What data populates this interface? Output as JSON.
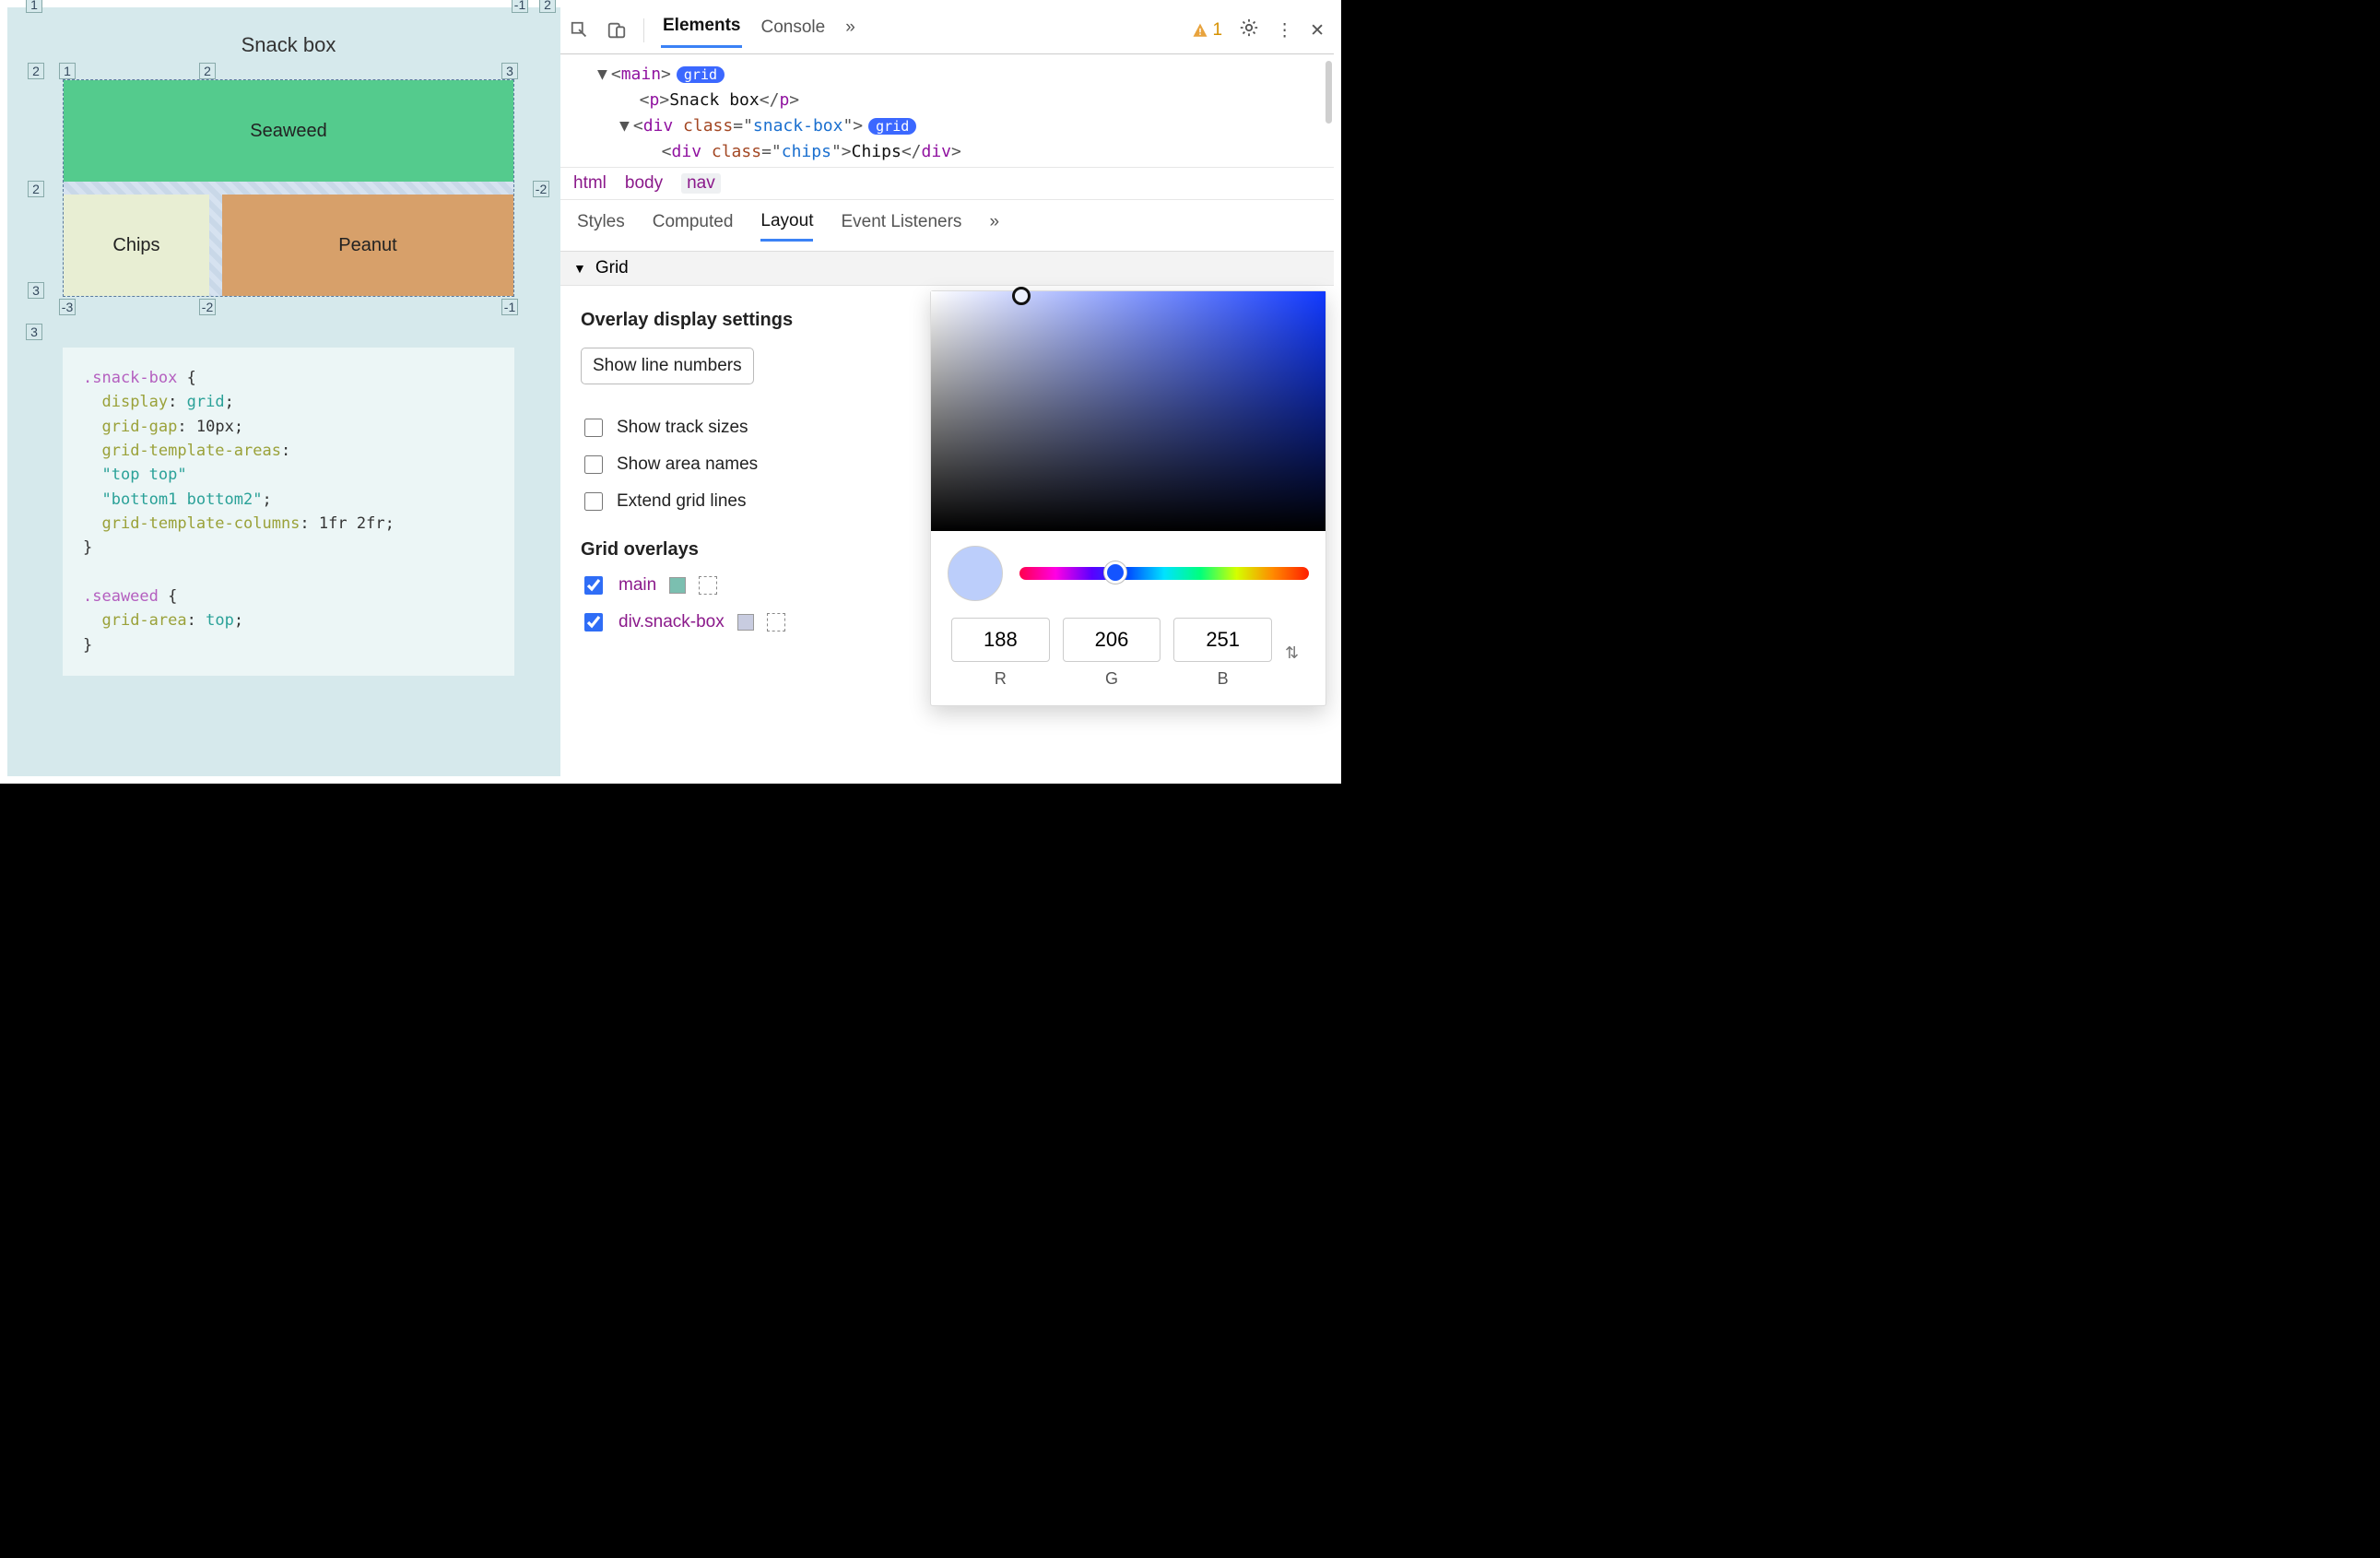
{
  "preview": {
    "title": "Snack box",
    "grid": {
      "seaweed": "Seaweed",
      "chips": "Chips",
      "peanut": "Peanut"
    },
    "lineLabels": {
      "topOuter1": "1",
      "rightOuterNeg1": "-1",
      "cornerTopRight": "2",
      "row2": "2",
      "col1": "1",
      "col2": "2",
      "col3": "3",
      "midRowLeft": "2",
      "midRowRight": "-2",
      "bottomCorner": "3",
      "botNeg3": "-3",
      "botNeg2": "-2",
      "botNeg1": "-1",
      "leftBottom": "3"
    },
    "css": {
      "rule1": {
        "selector": ".snack-box",
        "lines": [
          {
            "prop": "display",
            "val": "grid"
          },
          {
            "prop": "grid-gap",
            "val": "10px"
          },
          {
            "prop": "grid-template-areas",
            "val": ""
          },
          {
            "prop": "",
            "val": "\"top top\""
          },
          {
            "prop": "",
            "val": "\"bottom1 bottom2\";"
          },
          {
            "prop": "grid-template-columns",
            "val": "1fr 2fr"
          }
        ]
      },
      "rule2": {
        "selector": ".seaweed",
        "prop": "grid-area",
        "val": "top"
      }
    }
  },
  "devtools": {
    "topTabs": {
      "elements": "Elements",
      "console": "Console",
      "more": "»"
    },
    "warn": {
      "count": "1"
    },
    "dom": {
      "l1": {
        "pre": "▼",
        "tag": "main",
        "chip": "grid"
      },
      "l2": {
        "tag": "p",
        "text": "Snack box"
      },
      "l3": {
        "pre": "▼",
        "tag": "div",
        "attr": "class",
        "attrv": "snack-box",
        "chip": "grid"
      },
      "l4": {
        "tag": "div",
        "attr": "class",
        "attrv": "chips",
        "text": "Chips"
      }
    },
    "crumbs": [
      "html",
      "body",
      "nav"
    ],
    "panelTabs": {
      "styles": "Styles",
      "computed": "Computed",
      "layout": "Layout",
      "listeners": "Event Listeners",
      "more": "»"
    },
    "gridSection": "Grid",
    "layout": {
      "heading1": "Overlay display settings",
      "dropdown": "Show line numbers",
      "checks": {
        "tracks": "Show track sizes",
        "areas": "Show area names",
        "extend": "Extend grid lines"
      },
      "heading2": "Grid overlays",
      "overlays": [
        {
          "name": "main",
          "swatch": "#7bbfb0",
          "checked": true
        },
        {
          "name": "div.snack-box",
          "swatch": "#c8cce0",
          "checked": true
        }
      ]
    }
  },
  "colorpicker": {
    "r": "188",
    "g": "206",
    "b": "251",
    "color": "#bccefb",
    "labels": {
      "r": "R",
      "g": "G",
      "b": "B"
    }
  }
}
